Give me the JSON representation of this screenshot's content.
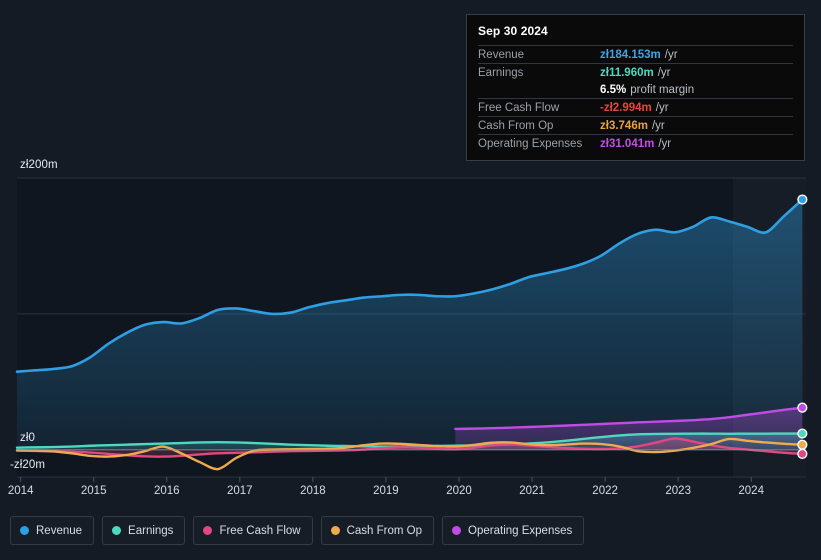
{
  "theme": {
    "background": "#151b24",
    "plot_background": "#10161f",
    "gridline": "#2b323c",
    "zero_line": "#8f97a1",
    "tooltip_bg": "#0a0a0a",
    "tooltip_border": "#3a3f46"
  },
  "tooltip": {
    "date": "Sep 30 2024",
    "rows": [
      {
        "key": "Revenue",
        "value": "zł184.153m",
        "suffix": "/yr",
        "color": "#3ba6e8"
      },
      {
        "key": "Earnings",
        "value": "zł11.960m",
        "suffix": "/yr",
        "color": "#4fd8c0"
      },
      {
        "key": "",
        "value": "6.5%",
        "suffix": "profit margin",
        "color": "#ffffff"
      },
      {
        "key": "Free Cash Flow",
        "value": "-zł2.994m",
        "suffix": "/yr",
        "color": "#e8453c"
      },
      {
        "key": "Cash From Op",
        "value": "zł3.746m",
        "suffix": "/yr",
        "color": "#e8a33d"
      },
      {
        "key": "Operating Expenses",
        "value": "zł31.041m",
        "suffix": "/yr",
        "color": "#c44ce8"
      }
    ]
  },
  "legend": {
    "items": [
      {
        "label": "Revenue",
        "color": "#2f9fe3"
      },
      {
        "label": "Earnings",
        "color": "#4fd8c0"
      },
      {
        "label": "Free Cash Flow",
        "color": "#e0487f"
      },
      {
        "label": "Cash From Op",
        "color": "#eeab4e"
      },
      {
        "label": "Operating Expenses",
        "color": "#c04ce8"
      }
    ]
  },
  "axes": {
    "y_top_label": "zł200m",
    "y_zero_label": "zł0",
    "y_neg_label": "-zł20m",
    "x_labels": [
      "2014",
      "2015",
      "2016",
      "2017",
      "2018",
      "2019",
      "2020",
      "2021",
      "2022",
      "2023",
      "2024"
    ]
  },
  "chart_data": {
    "type": "area",
    "title": "",
    "xlabel": "",
    "ylabel": "",
    "currency": "zł",
    "units": "millions per year",
    "xlim": [
      2013.95,
      2024.75
    ],
    "ylim": [
      -20,
      200
    ],
    "yticks": [
      -20,
      0,
      100,
      200
    ],
    "ytick_labels": [
      "-zł20m",
      "zł0",
      "",
      "zł200m"
    ],
    "grid": true,
    "legend_position": "bottom-left",
    "highlight_band": {
      "from": 2023.75,
      "to": 2024.75
    },
    "x": [
      2013.95,
      2014.2,
      2014.45,
      2014.7,
      2014.95,
      2015.2,
      2015.45,
      2015.7,
      2015.95,
      2016.2,
      2016.45,
      2016.7,
      2016.95,
      2017.2,
      2017.45,
      2017.7,
      2017.95,
      2018.2,
      2018.45,
      2018.7,
      2018.95,
      2019.2,
      2019.45,
      2019.7,
      2019.95,
      2020.2,
      2020.45,
      2020.7,
      2020.95,
      2021.2,
      2021.45,
      2021.7,
      2021.95,
      2022.2,
      2022.45,
      2022.7,
      2022.95,
      2023.2,
      2023.45,
      2023.7,
      2023.95,
      2024.2,
      2024.45,
      2024.7
    ],
    "series": [
      {
        "name": "Revenue",
        "color": "#2f9fe3",
        "filled": true,
        "values": [
          57.5,
          58.5,
          59.5,
          61.5,
          68,
          78,
          86,
          92,
          94,
          93,
          97,
          103,
          104,
          102,
          100,
          101,
          105,
          108,
          110,
          112,
          113,
          114,
          114,
          113,
          113,
          115,
          118,
          122,
          127,
          130,
          133,
          137,
          143,
          152,
          159,
          162,
          160,
          164,
          171,
          168,
          164,
          160,
          172,
          184.153
        ]
      },
      {
        "name": "Earnings",
        "color": "#4fd8c0",
        "filled": false,
        "values": [
          1.6,
          1.8,
          2.0,
          2.4,
          3.0,
          3.4,
          3.8,
          4.2,
          4.6,
          5.0,
          5.4,
          5.6,
          5.4,
          5.0,
          4.4,
          3.8,
          3.4,
          3.0,
          2.8,
          2.6,
          2.4,
          2.4,
          2.6,
          2.8,
          3.0,
          3.2,
          3.6,
          4.0,
          4.6,
          5.4,
          6.6,
          8.0,
          9.4,
          10.6,
          11.4,
          11.7,
          11.8,
          11.9,
          11.9,
          11.8,
          11.9,
          11.9,
          11.95,
          11.96
        ]
      },
      {
        "name": "Free Cash Flow",
        "color": "#e0487f",
        "filled": true,
        "values": [
          -0.6,
          -0.8,
          -1.0,
          -1.4,
          -2.0,
          -3.0,
          -4.0,
          -4.8,
          -5.0,
          -4.4,
          -3.4,
          -2.6,
          -2.2,
          -1.8,
          -1.4,
          -1.0,
          -0.8,
          -0.6,
          -0.4,
          0.2,
          1.2,
          1.8,
          1.6,
          0.8,
          0.4,
          1.6,
          3.2,
          4.0,
          3.2,
          2.2,
          1.4,
          0.8,
          0.6,
          1.0,
          2.6,
          5.4,
          8.4,
          6.2,
          3.4,
          1.4,
          0.2,
          -1.0,
          -2.2,
          -2.994
        ]
      },
      {
        "name": "Cash From Op",
        "color": "#eeab4e",
        "filled": false,
        "values": [
          -0.4,
          -0.6,
          -1.2,
          -2.6,
          -4.4,
          -5.0,
          -3.8,
          -1.0,
          2.4,
          -2.6,
          -9.0,
          -14.2,
          -6.0,
          -0.6,
          0.2,
          0.4,
          0.6,
          0.8,
          1.6,
          3.4,
          4.6,
          4.4,
          3.6,
          2.8,
          2.4,
          3.6,
          5.2,
          5.4,
          4.2,
          3.4,
          3.8,
          4.6,
          4.2,
          2.4,
          -1.0,
          -1.6,
          -0.6,
          1.4,
          4.2,
          8.0,
          6.6,
          5.4,
          4.4,
          3.746
        ]
      },
      {
        "name": "Operating Expenses",
        "color": "#c04ce8",
        "filled": true,
        "start_index": 24,
        "values": [
          null,
          null,
          null,
          null,
          null,
          null,
          null,
          null,
          null,
          null,
          null,
          null,
          null,
          null,
          null,
          null,
          null,
          null,
          null,
          null,
          null,
          null,
          null,
          null,
          15.4,
          15.6,
          15.9,
          16.3,
          16.8,
          17.3,
          17.8,
          18.4,
          19.0,
          19.6,
          20.2,
          20.7,
          21.2,
          21.8,
          22.6,
          24.0,
          25.8,
          27.6,
          29.4,
          31.041
        ]
      }
    ],
    "endpoints": [
      {
        "name": "Revenue",
        "value": 184.153,
        "color": "#2f9fe3"
      },
      {
        "name": "Operating Expenses",
        "value": 31.041,
        "color": "#c04ce8"
      },
      {
        "name": "Earnings",
        "value": 11.96,
        "color": "#4fd8c0"
      },
      {
        "name": "Cash From Op",
        "value": 3.746,
        "color": "#eeab4e"
      },
      {
        "name": "Free Cash Flow",
        "value": -2.994,
        "color": "#e0487f"
      }
    ]
  }
}
